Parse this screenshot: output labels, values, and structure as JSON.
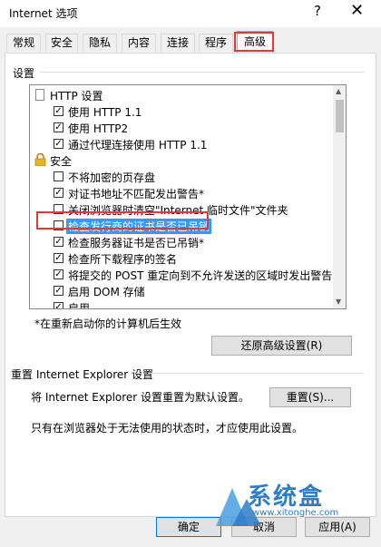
{
  "window": {
    "title": "Internet 选项",
    "help_glyph": "?",
    "close_glyph": "✕"
  },
  "tabs": [
    {
      "label": "常规",
      "active": false
    },
    {
      "label": "安全",
      "active": false
    },
    {
      "label": "隐私",
      "active": false
    },
    {
      "label": "内容",
      "active": false
    },
    {
      "label": "连接",
      "active": false
    },
    {
      "label": "程序",
      "active": false
    },
    {
      "label": "高级",
      "active": true
    }
  ],
  "settings": {
    "label": "设置",
    "items": [
      {
        "type": "header",
        "icon": "page-icon",
        "label": "HTTP 设置"
      },
      {
        "type": "checkbox",
        "checked": true,
        "label": "使用 HTTP 1.1"
      },
      {
        "type": "checkbox",
        "checked": true,
        "label": "使用 HTTP2"
      },
      {
        "type": "checkbox",
        "checked": true,
        "label": "通过代理连接使用 HTTP 1.1"
      },
      {
        "type": "header",
        "icon": "lock-icon",
        "label": "安全"
      },
      {
        "type": "checkbox",
        "checked": false,
        "label": "不将加密的页存盘"
      },
      {
        "type": "checkbox",
        "checked": true,
        "label": "对证书地址不匹配发出警告*"
      },
      {
        "type": "checkbox",
        "checked": false,
        "label": "关闭浏览器时清空\"Internet 临时文件\"文件夹"
      },
      {
        "type": "checkbox",
        "checked": false,
        "label": "检查发行商的证书是否已吊销",
        "selected": true
      },
      {
        "type": "checkbox",
        "checked": true,
        "label": "检查服务器证书是否已吊销*"
      },
      {
        "type": "checkbox",
        "checked": true,
        "label": "检查所下载程序的签名"
      },
      {
        "type": "checkbox",
        "checked": true,
        "label": "将提交的 POST 重定向到不允许发送的区域时发出警告"
      },
      {
        "type": "checkbox",
        "checked": true,
        "label": "启用 DOM 存储"
      },
      {
        "type": "checkbox",
        "checked": true,
        "label": "启用 ..."
      }
    ],
    "note": "*在重新启动你的计算机后生效",
    "restore_button": "还原高级设置(R)"
  },
  "reset": {
    "label": "重置 Internet Explorer 设置",
    "description": "将 Internet Explorer 设置重置为默认设置。",
    "button": "重置(S)...",
    "note": "只有在浏览器处于无法使用的状态时，才应使用此设置。"
  },
  "footer": {
    "ok": "确定",
    "cancel": "取消",
    "apply": "应用(A)"
  },
  "watermark": {
    "text": "系统盒",
    "url": "www.xitonghe.com"
  },
  "colors": {
    "highlight_red": "#e53935",
    "selection_blue": "#3399ff",
    "accent": "#0078d7"
  }
}
